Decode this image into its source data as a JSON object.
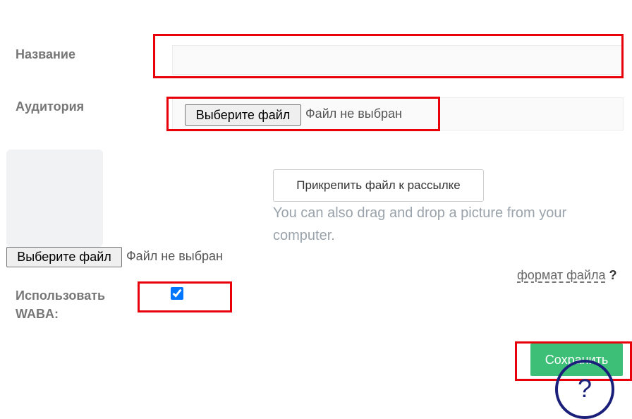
{
  "form": {
    "name_label": "Название",
    "audience_label": "Аудитория",
    "audience_file_button": "Выберите файл",
    "audience_file_status": "Файл не выбран",
    "image_file_button": "Выберите файл",
    "image_file_status": "Файл не выбран",
    "attach_button": "Прикрепить файл к рассылке",
    "drag_hint": "You can also drag and drop a picture from your computer.",
    "file_format_link": "формат файла",
    "file_format_help": "?",
    "waba_label_line1": "Использовать",
    "waba_label_line2": "WABA:",
    "waba_checked": true,
    "save_button": "Сохранить"
  },
  "help_button": {
    "glyph": "?"
  },
  "colors": {
    "highlight": "#e8000b",
    "save": "#3ebf78",
    "help": "#1a1f7a",
    "checkbox": "#0075ff"
  }
}
